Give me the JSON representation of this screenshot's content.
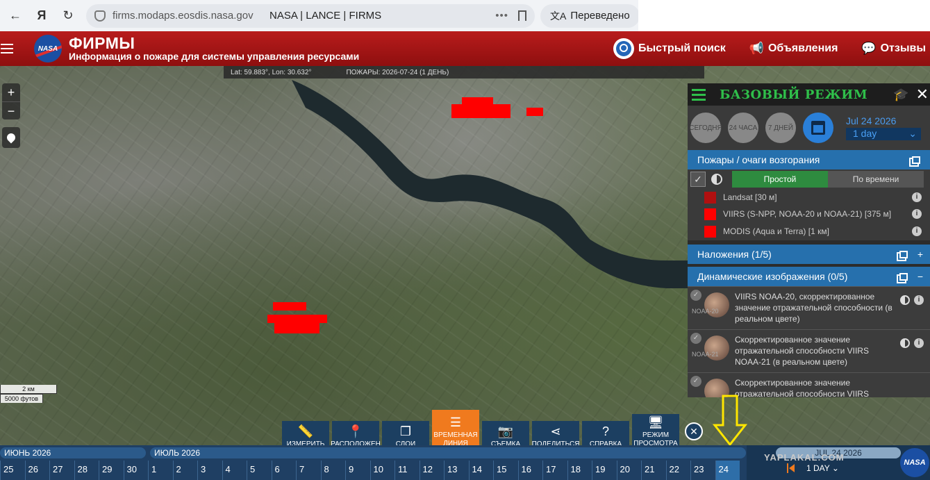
{
  "browser": {
    "url": "firms.modaps.eosdis.nasa.gov",
    "page_title": "NASA | LANCE | FIRMS",
    "translate_label": "Переведено",
    "more_icon": "more-dots-icon",
    "bookmark_icon": "bookmark-icon"
  },
  "header": {
    "logo_text": "NASA",
    "app_name": "ФИРМЫ",
    "subtitle": "Информация о пожаре для системы управления ресурсами",
    "quick_search": "Быстрый поиск",
    "announcements": "Объявления",
    "feedback": "Отзывы"
  },
  "map": {
    "coords": "Lat: 59.883°, Lon: 30.632°",
    "fires_label": "ПОЖАРЫ: 2026-07-24 (1 ДЕНЬ)",
    "zoom_in": "+",
    "zoom_out": "−",
    "scale_km": "2 км",
    "scale_ft": "5000 футов"
  },
  "panel": {
    "title": "БАЗОВЫЙ РЕЖИМ",
    "today": "СЕГОДНЯ",
    "h24": "24 ЧАСА",
    "d7": "7 ДНЕЙ",
    "date": "Jul 24 2026",
    "interval": "1 day",
    "fires_section": "Пожары / очаги возгорания",
    "mode_simple": "Простой",
    "mode_time": "По времени",
    "layers": [
      {
        "label": "Landsat [30 м]",
        "color": "#b01010"
      },
      {
        "label": "VIIRS (S-NPP, NOAA-20 и NOAA-21) [375 м]",
        "color": "#ff0000"
      },
      {
        "label": "MODIS (Aqua и Terra) [1 км]",
        "color": "#ff0000"
      }
    ],
    "overlays": "Наложения (1/5)",
    "dynamic": "Динамические изображения (0/5)",
    "images": [
      {
        "tag": "NOAA-20",
        "label": "VIIRS NOAA-20, скорректированное значение отражательной способности (в реальном цвете)"
      },
      {
        "tag": "NOAA-21",
        "label": "Скорректированное значение отражательной способности VIIRS NOAA-21 (в реальном цвете)"
      },
      {
        "tag": "",
        "label": "Скорректированное значение отражательной способности VIIRS"
      }
    ]
  },
  "toolbar": {
    "measure": "ИЗМЕРИТЬ",
    "locate": "РАСПОЛОЖЕН",
    "layers": "СЛОИ",
    "timeline_1": "ВРЕМЕННАЯ",
    "timeline_2": "ЛИНИЯ",
    "capture": "СЪЕМКА",
    "share": "ПОДЕЛИТЬСЯ",
    "help": "СПРАВКА",
    "view_1": "РЕЖИМ",
    "view_2": "ПРОСМОТРА",
    "close": "✕"
  },
  "timeline": {
    "month_june": "ИЮНЬ 2026",
    "month_july": "ИЮЛЬ 2026",
    "days": [
      "25",
      "26",
      "27",
      "28",
      "29",
      "30",
      "1",
      "2",
      "3",
      "4",
      "5",
      "6",
      "7",
      "8",
      "9",
      "10",
      "11",
      "12",
      "13",
      "14",
      "15",
      "16",
      "17",
      "18",
      "19",
      "20",
      "21",
      "22",
      "23",
      "24"
    ],
    "selected_day": "24",
    "current_date": "JUL 24 2026",
    "interval": "1 DAY",
    "watermark": "YAPLAKAL.COM"
  },
  "colors": {
    "header_red": "#a01515",
    "panel_green": "#2fbf4a",
    "section_blue": "#2670ad",
    "active_orange": "#f07a1e",
    "fire_red": "#ff0000",
    "annotation_yellow": "#ffe600"
  }
}
